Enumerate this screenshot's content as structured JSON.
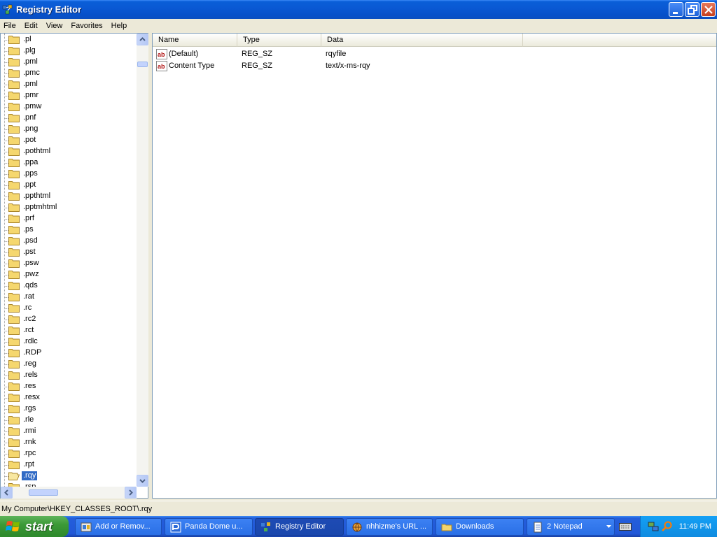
{
  "window": {
    "title": "Registry Editor"
  },
  "menu": [
    "File",
    "Edit",
    "View",
    "Favorites",
    "Help"
  ],
  "tree": {
    "items": [
      ".pl",
      ".plg",
      ".pml",
      ".pmc",
      ".pml",
      ".pmr",
      ".pmw",
      ".pnf",
      ".png",
      ".pot",
      ".pothtml",
      ".ppa",
      ".pps",
      ".ppt",
      ".ppthtml",
      ".pptmhtml",
      ".prf",
      ".ps",
      ".psd",
      ".pst",
      ".psw",
      ".pwz",
      ".qds",
      ".rat",
      ".rc",
      ".rc2",
      ".rct",
      ".rdlc",
      ".RDP",
      ".reg",
      ".rels",
      ".res",
      ".resx",
      ".rgs",
      ".rle",
      ".rmi",
      ".rnk",
      ".rpc",
      ".rpt",
      ".rqy",
      ".rsp"
    ],
    "selected": ".rqy"
  },
  "list": {
    "columns": [
      "Name",
      "Type",
      "Data"
    ],
    "rows": [
      {
        "name": "(Default)",
        "type": "REG_SZ",
        "data": "rqyfile"
      },
      {
        "name": "Content Type",
        "type": "REG_SZ",
        "data": "text/x-ms-rqy"
      }
    ]
  },
  "status": {
    "path": "My Computer\\HKEY_CLASSES_ROOT\\.rqy"
  },
  "taskbar": {
    "start_label": "start",
    "tasks": [
      {
        "label": "Add or Remov...",
        "icon": "control-panel-icon"
      },
      {
        "label": "Panda Dome u...",
        "icon": "panda-icon"
      },
      {
        "label": "Registry Editor",
        "icon": "regedit-icon",
        "active": true
      },
      {
        "label": "nhhizme's URL ...",
        "icon": "browser-icon"
      },
      {
        "label": "Downloads",
        "icon": "folder-icon"
      },
      {
        "label": "2 Notepad",
        "icon": "notepad-icon"
      }
    ],
    "clock": "11:49 PM"
  },
  "colors": {
    "title_bar": "#0a58d3",
    "selection": "#316ac5",
    "taskbar": "#245edb",
    "start_button": "#3c9a37"
  }
}
